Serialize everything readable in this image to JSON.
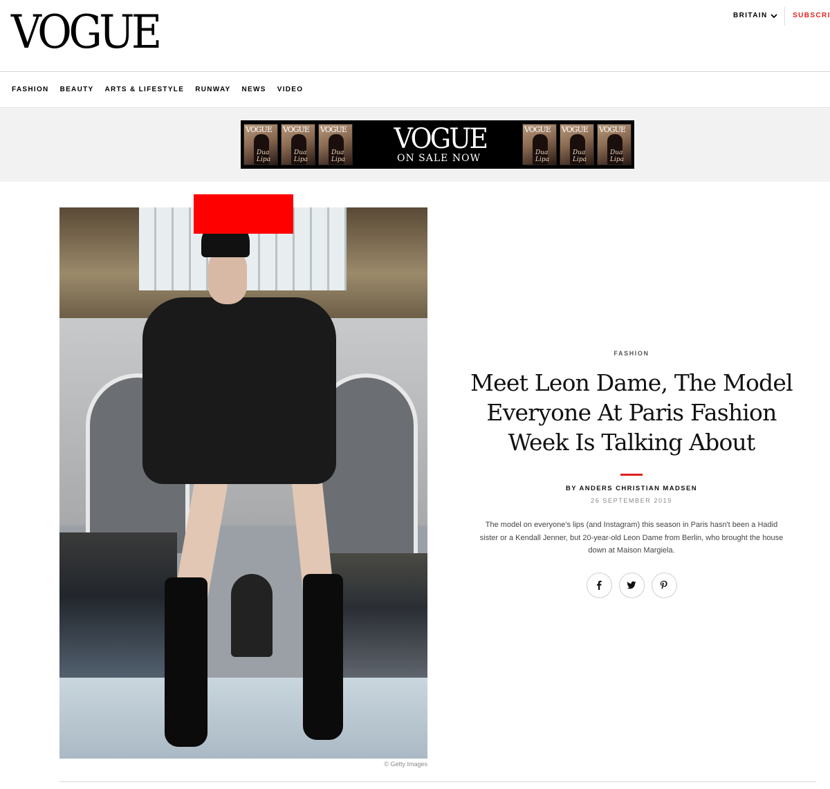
{
  "header": {
    "logo": "VOGUE",
    "edition": "BRITAIN",
    "subscribe": "SUBSCRIBE"
  },
  "nav": {
    "items": [
      "FASHION",
      "BEAUTY",
      "ARTS & LIFESTYLE",
      "RUNWAY",
      "NEWS",
      "VIDEO"
    ]
  },
  "ad": {
    "logo": "VOGUE",
    "tagline": "ON SALE NOW",
    "cover_title": "VOGUE",
    "cover_name": "Dua Lipa"
  },
  "hero": {
    "credit": "© Getty Images",
    "redact_color": "#ff0000"
  },
  "article": {
    "kicker": "FASHION",
    "headline": "Meet Leon Dame, The Model Everyone At Paris Fashion Week Is Talking About",
    "byline": "BY ANDERS CHRISTIAN MADSEN",
    "date": "26 SEPTEMBER 2019",
    "dek": "The model on everyone's lips (and Instagram) this season in Paris hasn't been a Hadid sister or a Kendall Jenner, but 20-year-old Leon Dame from Berlin, who brought the house down at Maison Margiela.",
    "share_icons": [
      "facebook-icon",
      "twitter-icon",
      "pinterest-icon"
    ]
  },
  "colors": {
    "accent": "#e0201c",
    "text": "#111111",
    "muted": "#888888"
  }
}
